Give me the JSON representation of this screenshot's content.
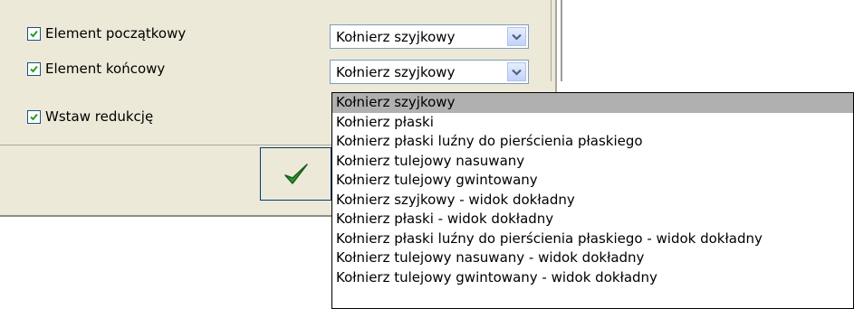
{
  "checkboxes": [
    {
      "label": "Element początkowy",
      "checked": true
    },
    {
      "label": "Element końcowy",
      "checked": true
    },
    {
      "label": "Wstaw redukcję",
      "checked": true
    }
  ],
  "combos": {
    "start": {
      "value": "Kołnierz szyjkowy"
    },
    "end": {
      "value": "Kołnierz szyjkowy"
    }
  },
  "ok_button": {
    "icon": "checkmark-icon",
    "color": "#2e9a2e"
  },
  "dropdown": {
    "selected_index": 0,
    "options": [
      "Kołnierz szyjkowy",
      "Kołnierz płaski",
      "Kołnierz płaski luźny do pierścienia płaskiego",
      "Kołnierz tulejowy nasuwany",
      "Kołnierz tulejowy gwintowany",
      "Kołnierz szyjkowy - widok dokładny",
      "Kołnierz płaski - widok dokładny",
      "Kołnierz płaski luźny do pierścienia płaskiego - widok dokładny",
      "Kołnierz tulejowy nasuwany - widok dokładny",
      "Kołnierz tulejowy gwintowany - widok dokładny"
    ]
  }
}
